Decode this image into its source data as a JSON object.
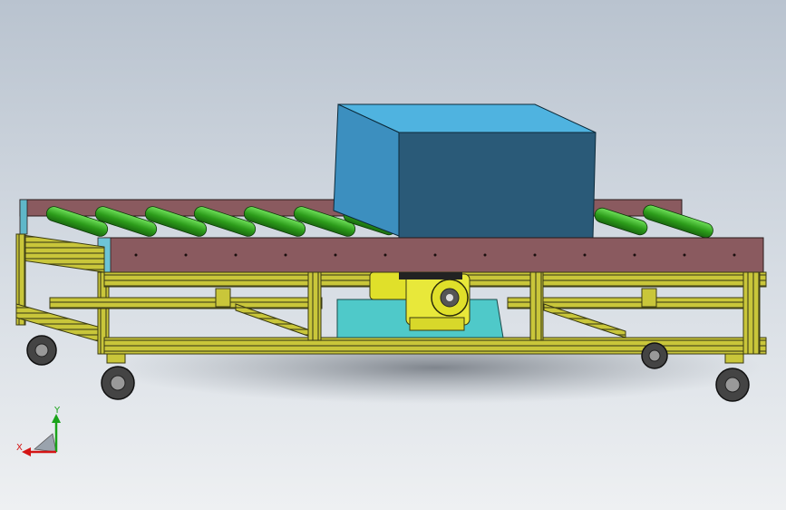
{
  "scene": {
    "description_colors": {
      "background_top": "#b9c3cf",
      "background_bottom": "#eef0f2",
      "frame": "#c9c63a",
      "frame_dark": "#4a4a1a",
      "rail": "#8a5a5f",
      "roller": "#34b11f",
      "box_front": "#2a5a78",
      "box_top": "#4fb3e0",
      "box_side": "#3c8fbf",
      "motor": "#e0e02a",
      "motor_plate": "#4fc9c9",
      "wheel": "#555555"
    }
  },
  "triad": {
    "x_label": "X",
    "y_label": "Y",
    "x_color": "#d41515",
    "y_color": "#1aa31a"
  }
}
